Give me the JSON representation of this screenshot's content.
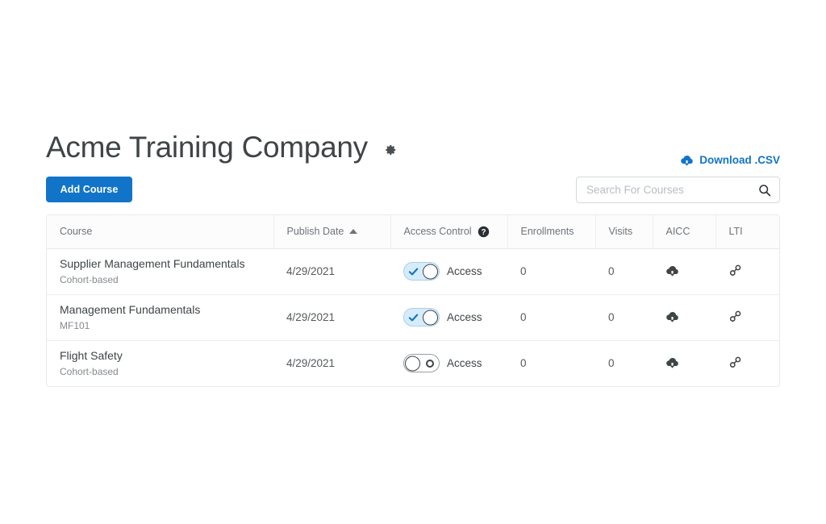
{
  "header": {
    "title": "Acme Training Company",
    "settings_icon": "gear-icon"
  },
  "toolbar": {
    "download_csv_label": "Download .CSV",
    "download_csv_icon": "cloud-download-icon",
    "add_course_label": "Add Course",
    "search_placeholder": "Search For Courses",
    "search_value": "",
    "search_icon": "search-icon"
  },
  "colors": {
    "accent_blue": "#1274c9",
    "link_blue": "#1274c9",
    "title_text": "#3f4447",
    "muted_text": "#6f7478",
    "toggle_on_track": "#d7ecfb",
    "toggle_on_check": "#1274c9",
    "border": "#e7e9eb"
  },
  "table": {
    "columns": [
      {
        "key": "course",
        "label": "Course",
        "sort": "none"
      },
      {
        "key": "publish_date",
        "label": "Publish Date",
        "sort": "asc"
      },
      {
        "key": "access_control",
        "label": "Access Control",
        "help_icon": "help-circle-icon"
      },
      {
        "key": "enrollments",
        "label": "Enrollments"
      },
      {
        "key": "visits",
        "label": "Visits"
      },
      {
        "key": "aicc",
        "label": "AICC"
      },
      {
        "key": "lti",
        "label": "LTI"
      }
    ],
    "rows": [
      {
        "course": "Supplier Management Fundamentals",
        "subtitle": "Cohort-based",
        "publish_date": "4/29/2021",
        "access_enabled": true,
        "access_label": "Access",
        "enrollments": "0",
        "visits": "0",
        "aicc_icon": "cloud-download-icon",
        "lti_icon": "link-icon"
      },
      {
        "course": "Management Fundamentals",
        "subtitle": "MF101",
        "publish_date": "4/29/2021",
        "access_enabled": true,
        "access_label": "Access",
        "enrollments": "0",
        "visits": "0",
        "aicc_icon": "cloud-download-icon",
        "lti_icon": "link-icon"
      },
      {
        "course": "Flight Safety",
        "subtitle": "Cohort-based",
        "publish_date": "4/29/2021",
        "access_enabled": false,
        "access_label": "Access",
        "enrollments": "0",
        "visits": "0",
        "aicc_icon": "cloud-download-icon",
        "lti_icon": "link-icon"
      }
    ]
  }
}
